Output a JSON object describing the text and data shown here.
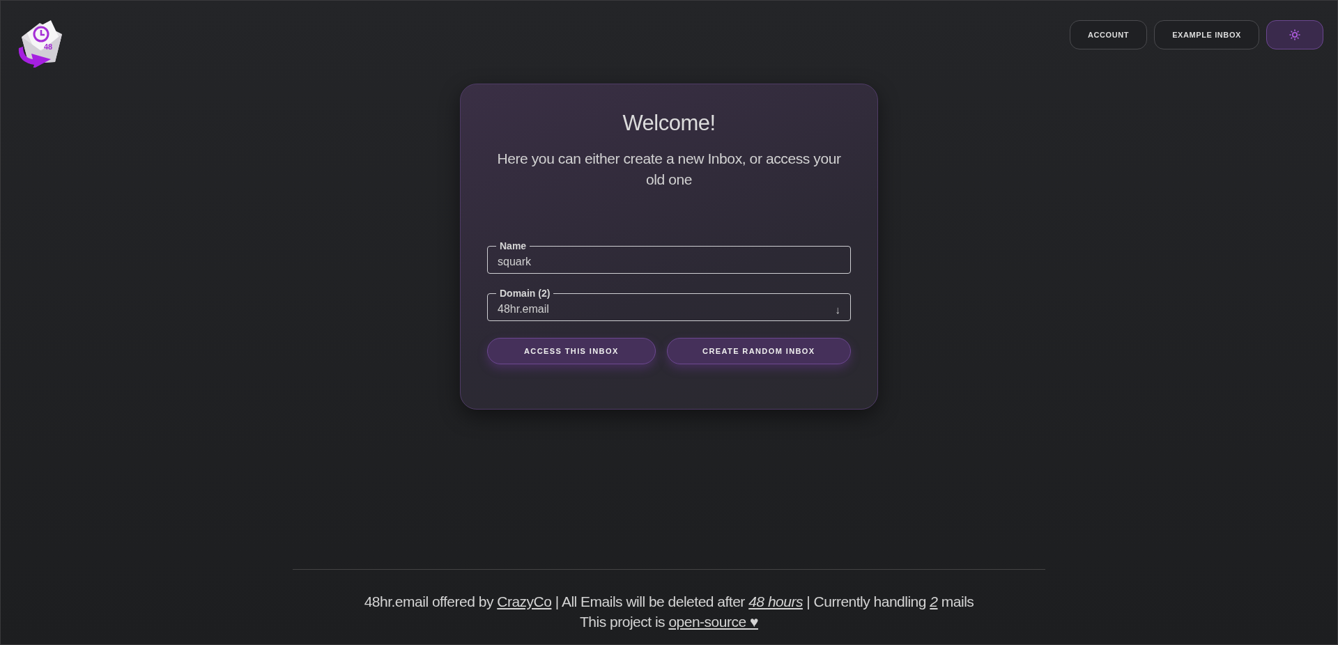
{
  "logo": {
    "badge": "48"
  },
  "nav": [
    {
      "label": "ACCOUNT"
    },
    {
      "label": "EXAMPLE INBOX"
    }
  ],
  "card": {
    "title": "Welcome!",
    "subtitle": "Here you can either create a new Inbox, or access your old one",
    "fields": [
      {
        "kind": "text",
        "label": "Name",
        "value": "squark"
      },
      {
        "kind": "select",
        "label": "Domain (2)",
        "value": "48hr.email",
        "arrow": "↓"
      }
    ],
    "buttons": [
      {
        "label": "ACCESS THIS INBOX"
      },
      {
        "label": "CREATE RANDOM INBOX"
      }
    ]
  },
  "footer": {
    "lines": [
      [
        {
          "kind": "text",
          "text": "48hr.email offered by "
        },
        {
          "kind": "link",
          "text": "CrazyCo",
          "italic": false
        },
        {
          "kind": "text",
          "text": " | All Emails will be deleted after "
        },
        {
          "kind": "link",
          "text": "48 hours",
          "italic": true
        },
        {
          "kind": "text",
          "text": " | Currently handling "
        },
        {
          "kind": "link",
          "text": "2",
          "italic": true
        },
        {
          "kind": "text",
          "text": " mails"
        }
      ],
      [
        {
          "kind": "text",
          "text": "This project is "
        },
        {
          "kind": "link",
          "text": "open-source ♥",
          "italic": false
        }
      ]
    ]
  }
}
